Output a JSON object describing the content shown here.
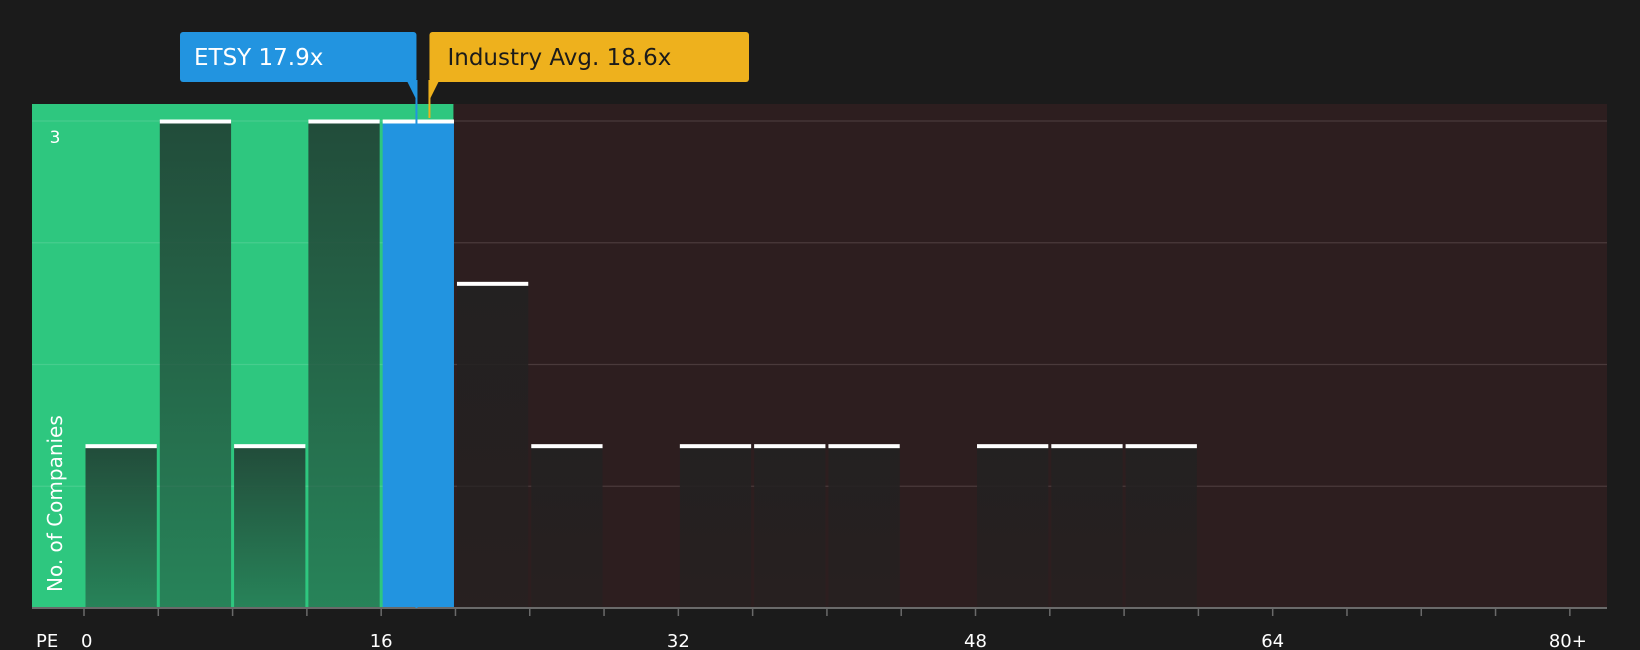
{
  "colors": {
    "background": "#1b1b1b",
    "below_region": "#2ec77f",
    "above_region": "#2d1e1f",
    "bar_below": "#224c3a",
    "bar_above": "#232121",
    "bar_company": "#2294e0",
    "bar_top_line": "#ffffff",
    "company_label_bg": "#2294e0",
    "industry_label_bg": "#eeb11d",
    "gridline": "#4a3a3b",
    "text": "#ffffff"
  },
  "labels": {
    "company": "ETSY 17.9x",
    "industry": "Industry Avg. 18.6x"
  },
  "chart_data": {
    "type": "bar",
    "title": "",
    "xlabel": "PE",
    "ylabel": "No. of Companies",
    "x_ticks": [
      "0",
      "16",
      "32",
      "48",
      "64",
      "80+"
    ],
    "x_tick_values": [
      0,
      16,
      32,
      48,
      64,
      80
    ],
    "y_ticks": [
      "3"
    ],
    "y_tick_values": [
      3
    ],
    "xlim": [
      -2.8,
      82
    ],
    "ylim": [
      0,
      3.15
    ],
    "bin_width": 4,
    "bins": [
      {
        "start": 0,
        "end": 4,
        "count": 1
      },
      {
        "start": 4,
        "end": 8,
        "count": 3
      },
      {
        "start": 8,
        "end": 12,
        "count": 1
      },
      {
        "start": 12,
        "end": 16,
        "count": 3
      },
      {
        "start": 16,
        "end": 20,
        "count": 3,
        "highlight": true
      },
      {
        "start": 20,
        "end": 24,
        "count": 2
      },
      {
        "start": 24,
        "end": 28,
        "count": 1
      },
      {
        "start": 28,
        "end": 32,
        "count": 0
      },
      {
        "start": 32,
        "end": 36,
        "count": 1
      },
      {
        "start": 36,
        "end": 40,
        "count": 1
      },
      {
        "start": 40,
        "end": 44,
        "count": 1
      },
      {
        "start": 44,
        "end": 48,
        "count": 0
      },
      {
        "start": 48,
        "end": 52,
        "count": 1
      },
      {
        "start": 52,
        "end": 56,
        "count": 1
      },
      {
        "start": 56,
        "end": 60,
        "count": 1
      }
    ],
    "company_value": 17.9,
    "industry_avg": 18.6,
    "below_region_end": 20,
    "grid": true,
    "grid_lines": 4
  }
}
